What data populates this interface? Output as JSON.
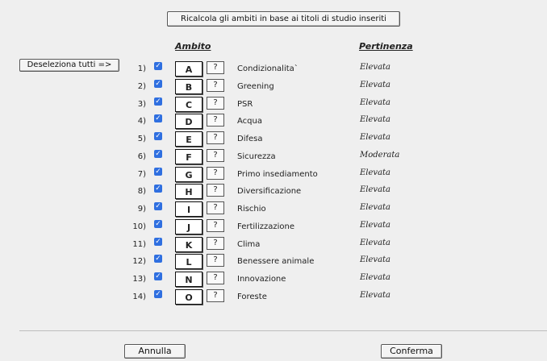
{
  "toolbar": {
    "recalc_label": "Ricalcola gli ambiti in base ai titoli di studio inseriti",
    "deselect_label": "Deseleziona tutti =>"
  },
  "table": {
    "header_ambito": "Ambito",
    "header_pertinenza": "Pertinenza",
    "rows": [
      {
        "num": "1)",
        "code": "A",
        "help": "?",
        "label": "Condizionalita`",
        "pertinenza": "Elevata",
        "checked": true
      },
      {
        "num": "2)",
        "code": "B",
        "help": "?",
        "label": "Greening",
        "pertinenza": "Elevata",
        "checked": true
      },
      {
        "num": "3)",
        "code": "C",
        "help": "?",
        "label": "PSR",
        "pertinenza": "Elevata",
        "checked": true
      },
      {
        "num": "4)",
        "code": "D",
        "help": "?",
        "label": "Acqua",
        "pertinenza": "Elevata",
        "checked": true
      },
      {
        "num": "5)",
        "code": "E",
        "help": "?",
        "label": "Difesa",
        "pertinenza": "Elevata",
        "checked": true
      },
      {
        "num": "6)",
        "code": "F",
        "help": "?",
        "label": "Sicurezza",
        "pertinenza": "Moderata",
        "checked": true
      },
      {
        "num": "7)",
        "code": "G",
        "help": "?",
        "label": "Primo insediamento",
        "pertinenza": "Elevata",
        "checked": true
      },
      {
        "num": "8)",
        "code": "H",
        "help": "?",
        "label": "Diversificazione",
        "pertinenza": "Elevata",
        "checked": true
      },
      {
        "num": "9)",
        "code": "I",
        "help": "?",
        "label": "Rischio",
        "pertinenza": "Elevata",
        "checked": true
      },
      {
        "num": "10)",
        "code": "J",
        "help": "?",
        "label": "Fertilizzazione",
        "pertinenza": "Elevata",
        "checked": true
      },
      {
        "num": "11)",
        "code": "K",
        "help": "?",
        "label": "Clima",
        "pertinenza": "Elevata",
        "checked": true
      },
      {
        "num": "12)",
        "code": "L",
        "help": "?",
        "label": "Benessere animale",
        "pertinenza": "Elevata",
        "checked": true
      },
      {
        "num": "13)",
        "code": "N",
        "help": "?",
        "label": "Innovazione",
        "pertinenza": "Elevata",
        "checked": true
      },
      {
        "num": "14)",
        "code": "O",
        "help": "?",
        "label": "Foreste",
        "pertinenza": "Elevata",
        "checked": true
      }
    ]
  },
  "footer": {
    "cancel_label": "Annulla",
    "confirm_label": "Conferma"
  },
  "colors": {
    "checkbox": "#2f6fe0",
    "background": "#efefef"
  },
  "icons": {
    "checkbox_glyph": "✓"
  }
}
